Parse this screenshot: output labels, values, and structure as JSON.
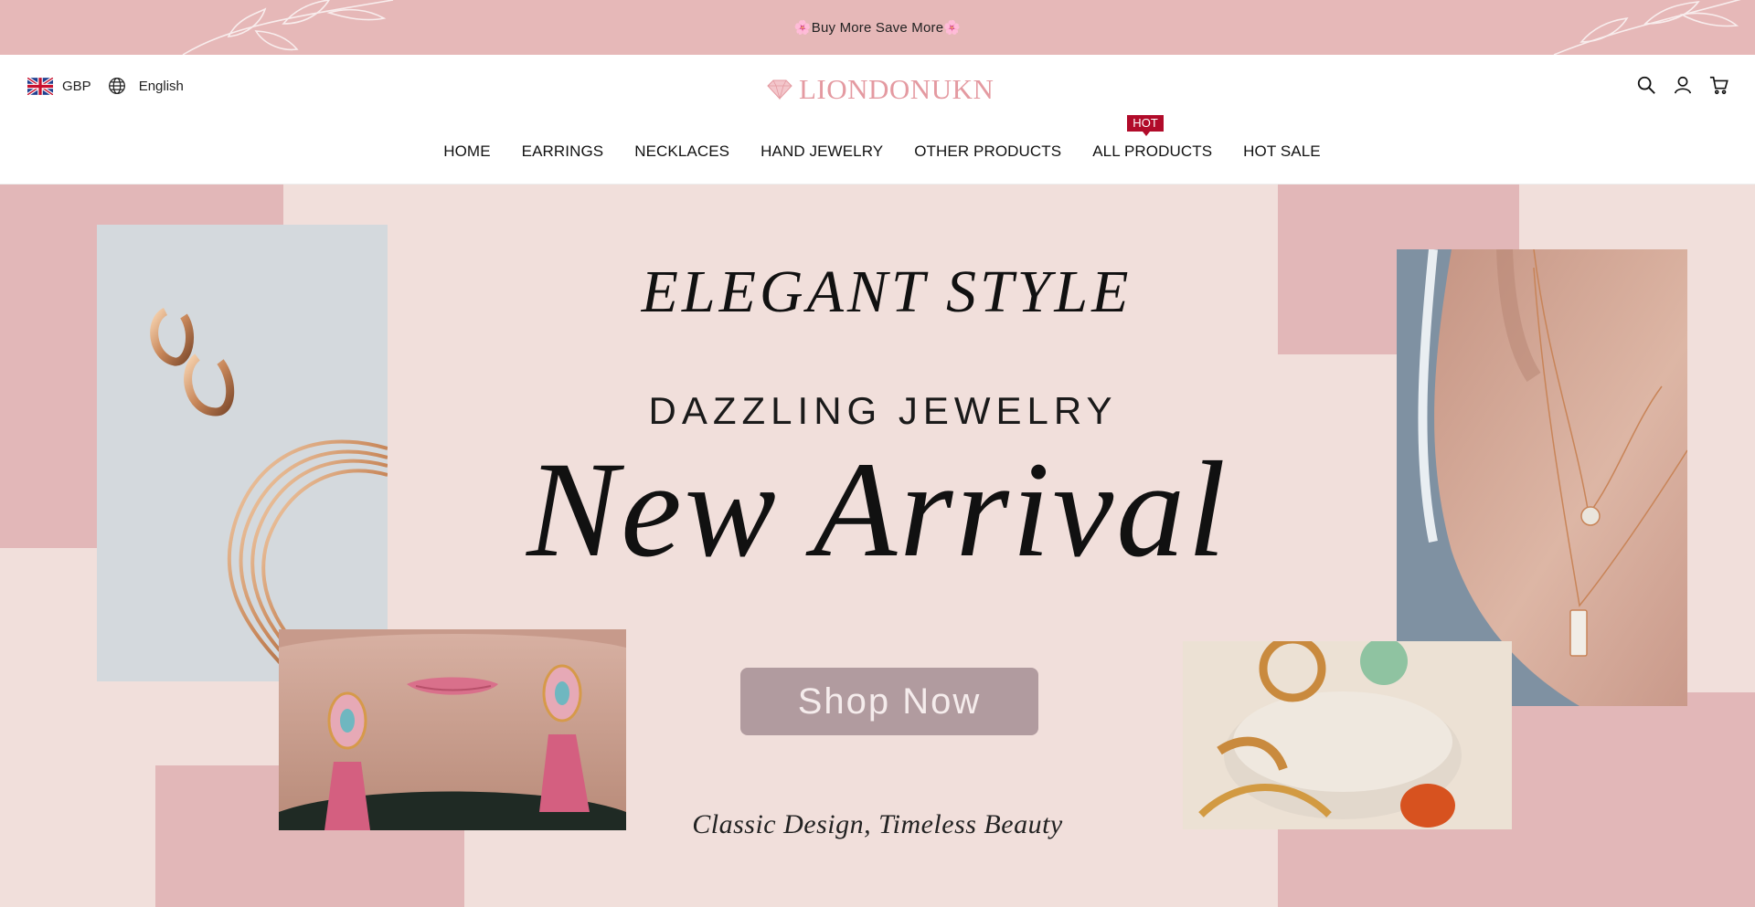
{
  "announcement": {
    "text": "🌸Buy More Save More🌸"
  },
  "header": {
    "currency": "GBP",
    "language": "English",
    "logo_text": "LIONDONUKN",
    "icons": [
      "search-icon",
      "account-icon",
      "cart-icon"
    ]
  },
  "nav": {
    "items": [
      {
        "label": "HOME"
      },
      {
        "label": "EARRINGS"
      },
      {
        "label": "NECKLACES"
      },
      {
        "label": "HAND JEWELRY"
      },
      {
        "label": "OTHER PRODUCTS"
      },
      {
        "label": "ALL PRODUCTS",
        "badge": "HOT"
      },
      {
        "label": "HOT SALE"
      }
    ]
  },
  "hero": {
    "headline": "ELEGANT STYLE",
    "subheadline": "DAZZLING JEWELRY",
    "title": "New Arrival",
    "button": "Shop Now",
    "tagline": "Classic Design, Timeless Beauty"
  },
  "colors": {
    "announcement_bg": "#e6b8b8",
    "hero_bg": "#f1dfdb",
    "accent_block": "#e2b7b8",
    "logo": "#e49aa1",
    "badge": "#b10b2a",
    "button": "#b19b9f"
  }
}
